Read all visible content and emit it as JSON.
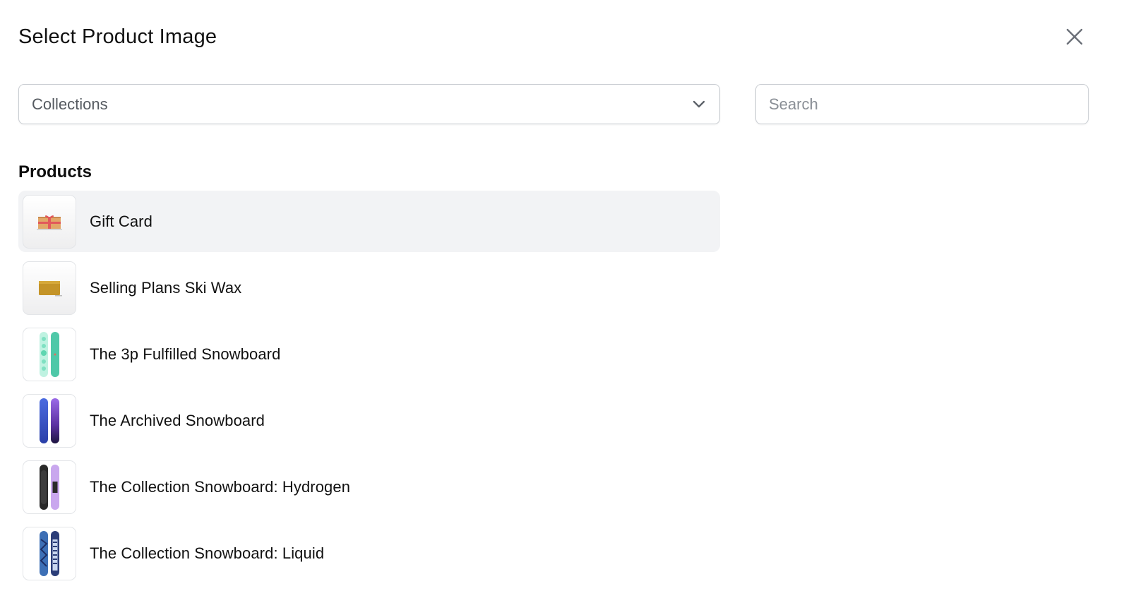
{
  "dialog": {
    "title": "Select Product Image",
    "close_icon": "close-icon"
  },
  "filters": {
    "collections_select": {
      "value": "Collections",
      "icon": "chevron-down-icon"
    },
    "search": {
      "placeholder": "Search",
      "value": ""
    }
  },
  "products_section": {
    "heading": "Products",
    "items": [
      {
        "name": "Gift Card",
        "thumbnail": "gift-card-icon",
        "selected": true
      },
      {
        "name": "Selling Plans Ski Wax",
        "thumbnail": "ski-wax-icon",
        "selected": false
      },
      {
        "name": "The 3p Fulfilled Snowboard",
        "thumbnail": "snowboard-teal-icon",
        "selected": false
      },
      {
        "name": "The Archived Snowboard",
        "thumbnail": "snowboard-blue-purple-icon",
        "selected": false
      },
      {
        "name": "The Collection Snowboard: Hydrogen",
        "thumbnail": "snowboard-black-lilac-icon",
        "selected": false
      },
      {
        "name": "The Collection Snowboard: Liquid",
        "thumbnail": "snowboard-navy-icon",
        "selected": false
      }
    ]
  },
  "colors": {
    "selected_row_bg": "#f2f3f5",
    "border": "#c9cdd2",
    "text": "#111111",
    "placeholder": "#8a8f96"
  }
}
